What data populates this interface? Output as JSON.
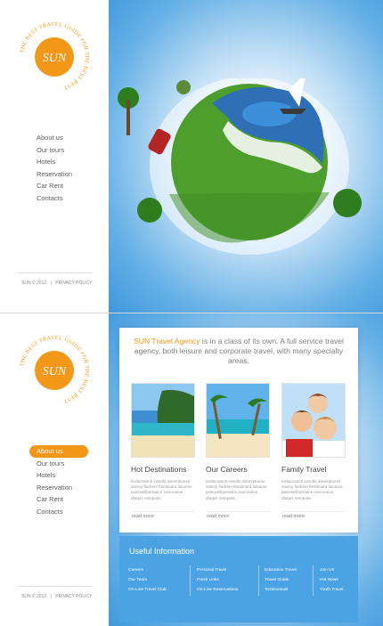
{
  "logo": {
    "text": "SUN",
    "ring_text": "THE BEST TRAVEL GUIDE FOR THE BEST REST",
    "color": "#f29718"
  },
  "colors": {
    "accent": "#f29718",
    "sky": "#4ba3e4",
    "text": "#5e5e5e"
  },
  "nav": {
    "items": [
      "About us",
      "Our tours",
      "Hotels",
      "Reservation",
      "Car Rent",
      "Contacts"
    ],
    "active_index_panel2": 0
  },
  "footer": {
    "copyright": "SUN © 2012",
    "separator": "|",
    "privacy": "PRIVACY POLICY"
  },
  "intro": {
    "brand": "SUN Travel Agency",
    "text": " is in a class of its own. A full service travel agency, both leisure and corporate travel, with many specialty areas."
  },
  "features": [
    {
      "title": "Hot Destinations",
      "text": "Kellacraenti vesolle danerptuese savmy fiedreer llentsnara lasuene jaseraelfpartaace suscvarius dlaqus netopata.",
      "more": "read more",
      "image": "tropical-beach"
    },
    {
      "title": "Our Careers",
      "text": "Kellacraenti vesolle danerptuese savmy fiedreer llentsnara lasuene jaseraelfpartaace suscvarius dlaqus netopata.",
      "more": "read more",
      "image": "palm-beach"
    },
    {
      "title": "Family Travel",
      "text": "Kellacraenti vesolle danerptuese savmy fiedreer llentsnara lasuene jaseraelfpartaace suscvarius dlaqus netopata.",
      "more": "read more",
      "image": "family-photo"
    }
  ],
  "useful": {
    "title": "Useful Information",
    "columns": [
      [
        "Careers",
        "Our Team",
        "On-Line Travel Club"
      ],
      [
        "Personal Travel",
        "Fresh Links",
        "On-Line Reservations"
      ],
      [
        "Education Travel",
        "Travel Guide",
        "Testimonials"
      ],
      [
        "Join Us",
        "Hot News",
        "Youth Travel"
      ]
    ]
  }
}
